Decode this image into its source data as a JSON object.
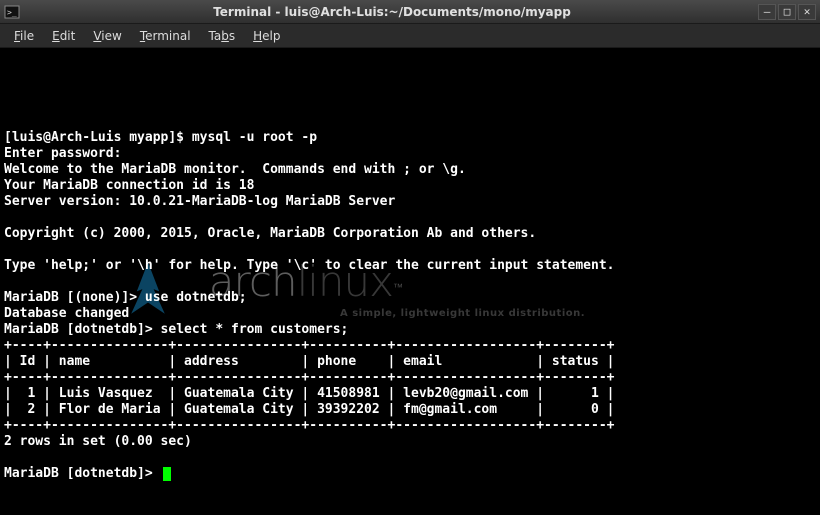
{
  "window": {
    "title": "Terminal - luis@Arch-Luis:~/Documents/mono/myapp"
  },
  "menu": {
    "file": "File",
    "edit": "Edit",
    "view": "View",
    "terminal": "Terminal",
    "tabs": "Tabs",
    "help": "Help"
  },
  "watermark": {
    "arch": "arch",
    "linux": "linux",
    "tm": "™",
    "subtitle": "A simple, lightweight linux distribution."
  },
  "session": {
    "shell_prompt": "[luis@Arch-Luis myapp]$ ",
    "shell_cmd": "mysql -u root -p",
    "pw_line": "Enter password:",
    "welcome1": "Welcome to the MariaDB monitor.  Commands end with ; or \\g.",
    "welcome2": "Your MariaDB connection id is 18",
    "welcome3": "Server version: 10.0.21-MariaDB-log MariaDB Server",
    "copyright": "Copyright (c) 2000, 2015, Oracle, MariaDB Corporation Ab and others.",
    "help_line": "Type 'help;' or '\\h' for help. Type '\\c' to clear the current input statement.",
    "prompt_none": "MariaDB [(none)]> ",
    "cmd_use": "use dotnetdb;",
    "db_changed": "Database changed",
    "prompt_db": "MariaDB [dotnetdb]> ",
    "cmd_select": "select * from customers;",
    "rows_msg": "2 rows in set (0.00 sec)"
  },
  "table": {
    "border": "+----+---------------+----------------+----------+------------------+--------+",
    "header": "| Id | name          | address        | phone    | email            | status |",
    "rows": [
      "|  1 | Luis Vasquez  | Guatemala City | 41508981 | levb20@gmail.com |      1 |",
      "|  2 | Flor de Maria | Guatemala City | 39392202 | fm@gmail.com     |      0 |"
    ]
  },
  "chart_data": {
    "type": "table",
    "columns": [
      "Id",
      "name",
      "address",
      "phone",
      "email",
      "status"
    ],
    "rows": [
      {
        "Id": 1,
        "name": "Luis Vasquez",
        "address": "Guatemala City",
        "phone": "41508981",
        "email": "levb20@gmail.com",
        "status": 1
      },
      {
        "Id": 2,
        "name": "Flor de Maria",
        "address": "Guatemala City",
        "phone": "39392202",
        "email": "fm@gmail.com",
        "status": 0
      }
    ]
  }
}
